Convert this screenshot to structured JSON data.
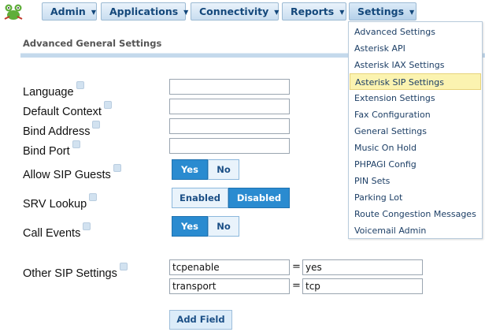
{
  "nav": {
    "items": [
      {
        "label": "Admin"
      },
      {
        "label": "Applications"
      },
      {
        "label": "Connectivity"
      },
      {
        "label": "Reports"
      },
      {
        "label": "Settings"
      }
    ]
  },
  "menu": {
    "items": [
      {
        "label": "Advanced Settings"
      },
      {
        "label": "Asterisk API"
      },
      {
        "label": "Asterisk IAX Settings"
      },
      {
        "label": "Asterisk SIP Settings",
        "highlighted": true
      },
      {
        "label": "Extension Settings"
      },
      {
        "label": "Fax Configuration"
      },
      {
        "label": "General Settings"
      },
      {
        "label": "Music On Hold"
      },
      {
        "label": "PHPAGI Config"
      },
      {
        "label": "PIN Sets"
      },
      {
        "label": "Parking Lot"
      },
      {
        "label": "Route Congestion Messages"
      },
      {
        "label": "Voicemail Admin"
      }
    ]
  },
  "page": {
    "section_title": "Advanced General Settings"
  },
  "form": {
    "language": {
      "label": "Language",
      "value": ""
    },
    "default_context": {
      "label": "Default Context",
      "value": ""
    },
    "bind_address": {
      "label": "Bind Address",
      "value": ""
    },
    "bind_port": {
      "label": "Bind Port",
      "value": ""
    },
    "allow_sip_guests": {
      "label": "Allow SIP Guests",
      "yes": "Yes",
      "no": "No",
      "selected": "Yes"
    },
    "srv_lookup": {
      "label": "SRV Lookup",
      "enabled": "Enabled",
      "disabled": "Disabled",
      "selected": "Disabled"
    },
    "call_events": {
      "label": "Call Events",
      "yes": "Yes",
      "no": "No",
      "selected": "Yes"
    },
    "other_sip": {
      "label": "Other SIP Settings",
      "rows": [
        {
          "key": "tcpenable",
          "eq": "=",
          "value": "yes"
        },
        {
          "key": "transport",
          "eq": "=",
          "value": "tcp"
        }
      ]
    },
    "add_field_label": "Add Field"
  },
  "colors": {
    "accent": "#2a8bd0",
    "menu_highlight": "#fbf3b0",
    "nav_text": "#14487b"
  }
}
